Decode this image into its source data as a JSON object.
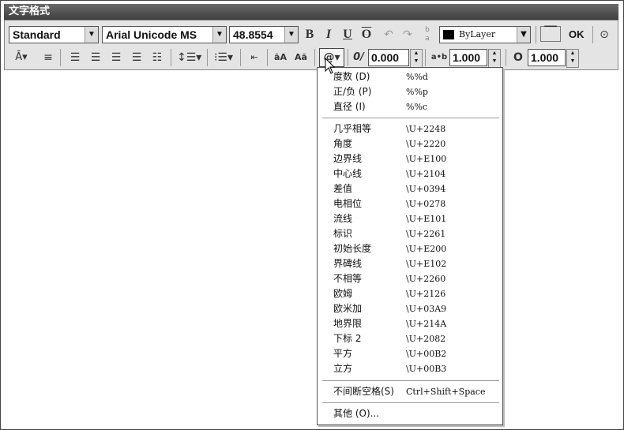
{
  "window": {
    "title": "文字格式"
  },
  "toolbar": {
    "style_value": "Standard",
    "font_value": "Arial Unicode MS",
    "height_value": "48.8554",
    "bold": "B",
    "italic": "I",
    "underline": "U",
    "overline": "O",
    "color_value": "ByLayer",
    "ok_label": "OK",
    "oblique_icon_text": "0/",
    "oblique_value": "0.000",
    "tracking_icon_text": "a•b",
    "tracking_value": "1.000",
    "width_icon_text": "O",
    "width_value": "1.000",
    "uppercase_text": "āA",
    "lowercase_text": "Aā",
    "symbol_text": "@"
  },
  "symbol_menu": {
    "group1": [
      {
        "label": "度数 (D)",
        "code": "%%d"
      },
      {
        "label": "正/负 (P)",
        "code": "%%p"
      },
      {
        "label": "直径 (I)",
        "code": "%%c"
      }
    ],
    "group2": [
      {
        "label": "几乎相等",
        "code": "\\U+2248"
      },
      {
        "label": "角度",
        "code": "\\U+2220"
      },
      {
        "label": "边界线",
        "code": "\\U+E100"
      },
      {
        "label": "中心线",
        "code": "\\U+2104"
      },
      {
        "label": "差值",
        "code": "\\U+0394"
      },
      {
        "label": "电相位",
        "code": "\\U+0278"
      },
      {
        "label": "流线",
        "code": "\\U+E101"
      },
      {
        "label": "标识",
        "code": "\\U+2261"
      },
      {
        "label": "初始长度",
        "code": "\\U+E200"
      },
      {
        "label": "界碑线",
        "code": "\\U+E102"
      },
      {
        "label": "不相等",
        "code": "\\U+2260"
      },
      {
        "label": "欧姆",
        "code": "\\U+2126"
      },
      {
        "label": "欧米加",
        "code": "\\U+03A9"
      },
      {
        "label": "地界限",
        "code": "\\U+214A"
      },
      {
        "label": "下标 2",
        "code": "\\U+2082"
      },
      {
        "label": "平方",
        "code": "\\U+00B2"
      },
      {
        "label": "立方",
        "code": "\\U+00B3"
      }
    ],
    "nbsp": {
      "label": "不间断空格(S)",
      "code": "Ctrl+Shift+Space"
    },
    "other": {
      "label": "其他 (O)..."
    }
  }
}
